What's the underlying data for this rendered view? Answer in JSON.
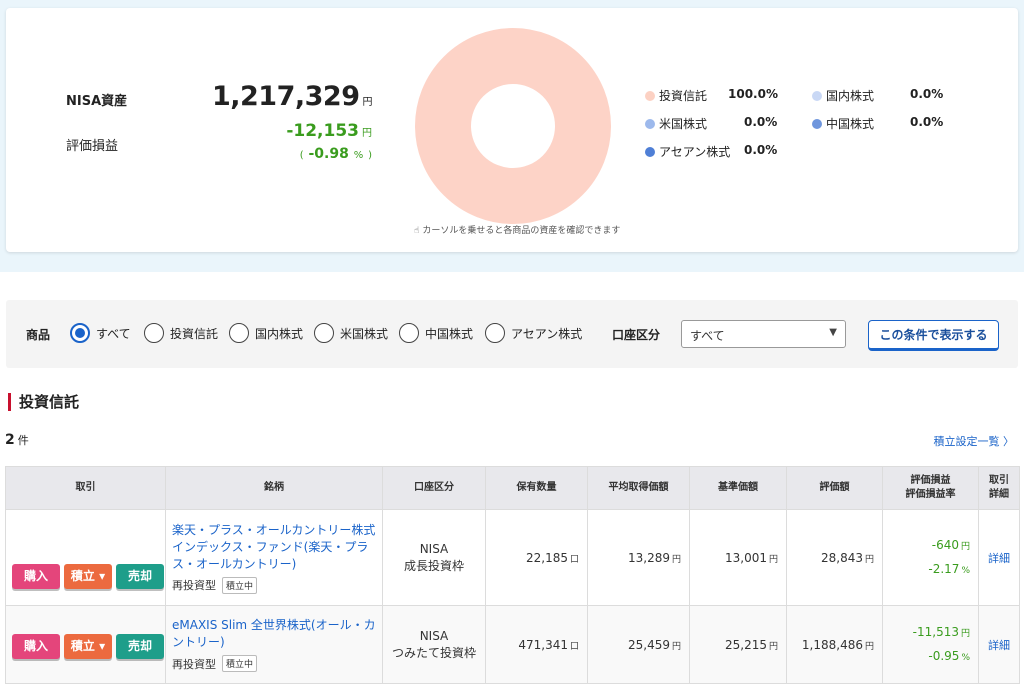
{
  "summary": {
    "nisa_label": "NISA資産",
    "total_value": "1,217,329",
    "yen_unit": "円",
    "pl_label": "評価損益",
    "pl_value": "-12,153",
    "pl_rate_open": "(",
    "pl_rate": "-0.98",
    "pl_rate_unit": "%",
    "pl_rate_close": ")",
    "hint": "カーソルを乗せると各商品の資産を確認できます",
    "donut_color": "#fdd3c7",
    "legend": [
      {
        "name": "投資信託",
        "value": "100.0%",
        "color": "#fcd1c3"
      },
      {
        "name": "国内株式",
        "value": "0.0%",
        "color": "#c9d8f5"
      },
      {
        "name": "米国株式",
        "value": "0.0%",
        "color": "#9db9ec"
      },
      {
        "name": "中国株式",
        "value": "0.0%",
        "color": "#6f96dd"
      },
      {
        "name": "アセアン株式",
        "value": "0.0%",
        "color": "#4f7fd6"
      }
    ]
  },
  "filter": {
    "product_label": "商品",
    "options": [
      "すべて",
      "投資信託",
      "国内株式",
      "米国株式",
      "中国株式",
      "アセアン株式"
    ],
    "selected_index": 0,
    "account_label": "口座区分",
    "account_value": "すべて",
    "submit_label": "この条件で表示する"
  },
  "section": {
    "title": "投資信託",
    "count": "2",
    "count_unit": "件",
    "tsumitate_link": "積立設定一覧 〉"
  },
  "table": {
    "headers": {
      "trade": "取引",
      "name": "銘柄",
      "account": "口座区分",
      "quantity": "保有数量",
      "avg_price": "平均取得価額",
      "base_price": "基準価額",
      "value": "評価額",
      "pl_line1": "評価損益",
      "pl_line2": "評価損益率",
      "detail_line1": "取引",
      "detail_line2": "詳細"
    },
    "buttons": {
      "buy": "購入",
      "tsumitate": "積立 ▾",
      "sell": "売却"
    },
    "rows": [
      {
        "name": "楽天・プラス・オールカントリー株式インデックス・ファンド(楽天・プラス・オールカントリー)",
        "type": "再投資型",
        "badge": "積立中",
        "account_line1": "NISA",
        "account_line2": "成長投資枠",
        "quantity": "22,185",
        "quantity_unit": "口",
        "avg_price": "13,289",
        "base_price": "13,001",
        "value": "28,843",
        "pl": "-640",
        "pl_rate": "-2.17",
        "detail": "詳細"
      },
      {
        "name": "eMAXIS Slim 全世界株式(オール・カントリー)",
        "type": "再投資型",
        "badge": "積立中",
        "account_line1": "NISA",
        "account_line2": "つみたて投資枠",
        "quantity": "471,341",
        "quantity_unit": "口",
        "avg_price": "25,459",
        "base_price": "25,215",
        "value": "1,188,486",
        "pl": "-11,513",
        "pl_rate": "-0.95",
        "detail": "詳細"
      }
    ],
    "yen_unit": "円",
    "pct_unit": "%"
  }
}
